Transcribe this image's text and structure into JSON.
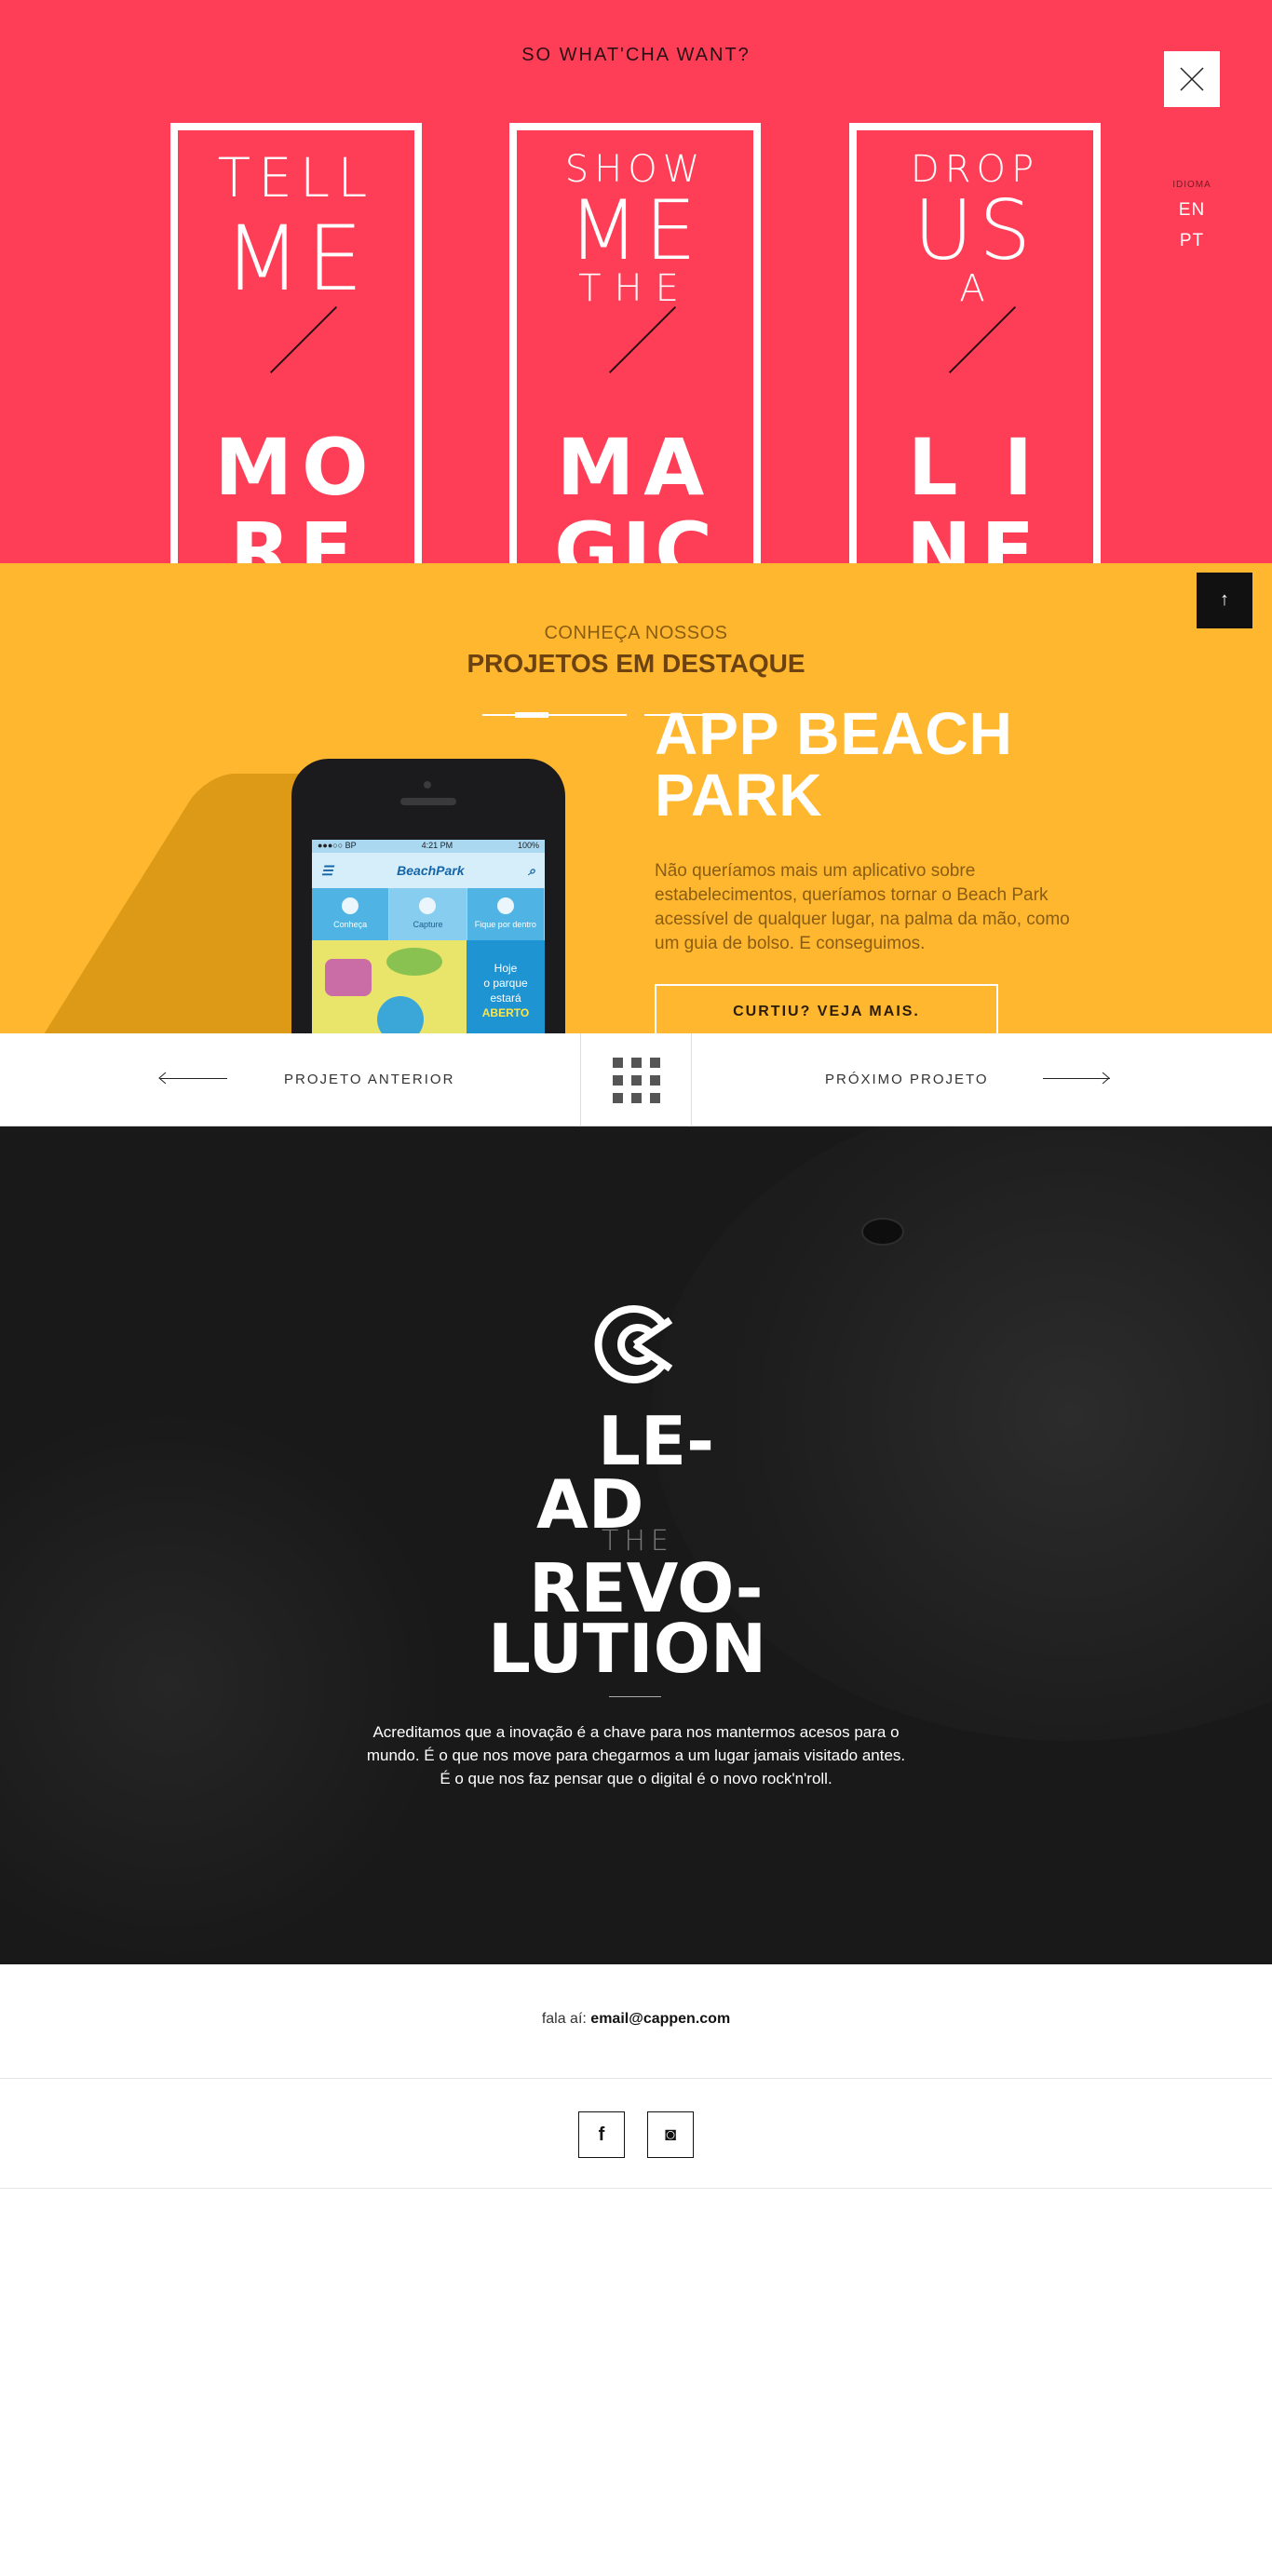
{
  "hero": {
    "title": "SO WHAT'CHA WANT?",
    "language": {
      "label": "IDIOMA",
      "options": [
        "EN",
        "PT"
      ]
    },
    "cards": [
      {
        "lines": [
          "TELL",
          "ME"
        ],
        "big": [
          "MO",
          "RE"
        ]
      },
      {
        "lines": [
          "SHOW",
          "ME",
          "THE"
        ],
        "big": [
          "MA",
          "GIC"
        ]
      },
      {
        "lines": [
          "DROP",
          "US",
          "A"
        ],
        "big": [
          "L I",
          "NE"
        ]
      }
    ],
    "colors": {
      "background": "#fe3e56"
    }
  },
  "project": {
    "subtitle": "CONHEÇA NOSSOS",
    "heading": "PROJETOS EM DESTAQUE",
    "title": "APP BEACH PARK",
    "description": "Não queríamos mais um aplicativo sobre estabelecimentos, queríamos tornar o Beach Park acessível de qualquer lugar, na palma da mão, como um guia de bolso. E conseguimos.",
    "cta": "CURTIU? VEJA MAIS.",
    "colors": {
      "background": "#ffb72f"
    },
    "phone": {
      "status_left": "●●●○○ BP",
      "status_time": "4:21 PM",
      "status_right": "100%",
      "app_name": "BeachPark",
      "tabs": [
        "Conheça",
        "Capture",
        "Fique por dentro"
      ],
      "open_text": [
        "Hoje",
        "o parque",
        "estará"
      ],
      "open_status": "ABERTO"
    }
  },
  "project_nav": {
    "prev": "PROJETO ANTERIOR",
    "next": "PRÓXIMO PROJETO"
  },
  "revolution": {
    "words": [
      "LE-",
      "AD",
      "THE",
      "REVO-",
      "LUTION"
    ],
    "text": "Acreditamos que a inovação é a chave para nos mantermos acesos para o mundo. É o que nos move para chegarmos a um lugar jamais visitado antes. É o que nos faz pensar que o digital é o novo rock'n'roll."
  },
  "contact": {
    "prefix": "fala aí:",
    "email": "email@cappen.com"
  },
  "social": [
    {
      "icon": "facebook-icon",
      "glyph": "f"
    },
    {
      "icon": "instagram-icon",
      "glyph": "◙"
    }
  ]
}
